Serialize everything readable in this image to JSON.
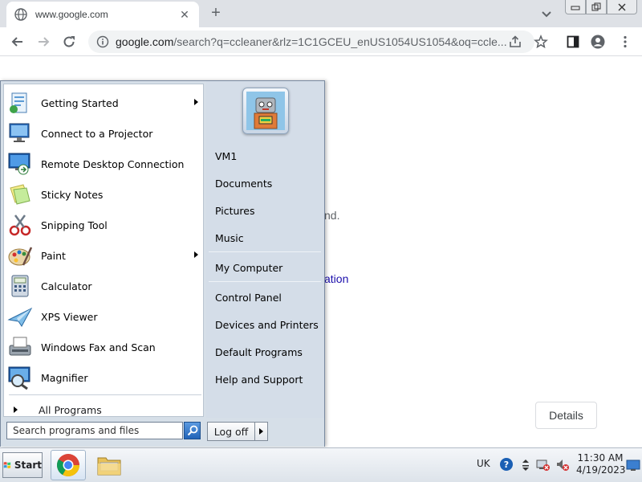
{
  "browser": {
    "tab_title": "www.google.com",
    "url_host": "google.com",
    "url_rest": "/search?q=ccleaner&rlz=1C1GCEU_enUS1054US1054&oq=ccle..."
  },
  "page": {
    "fragment_1": "nd.",
    "fragment_2": "ation",
    "details_label": "Details"
  },
  "start_menu": {
    "programs": [
      {
        "label": "Getting Started",
        "icon": "getting-started-icon",
        "submenu": true
      },
      {
        "label": "Connect to a Projector",
        "icon": "projector-icon",
        "submenu": false
      },
      {
        "label": "Remote Desktop Connection",
        "icon": "remote-desktop-icon",
        "submenu": false
      },
      {
        "label": "Sticky Notes",
        "icon": "sticky-notes-icon",
        "submenu": false
      },
      {
        "label": "Snipping Tool",
        "icon": "snipping-tool-icon",
        "submenu": false
      },
      {
        "label": "Paint",
        "icon": "paint-icon",
        "submenu": true
      },
      {
        "label": "Calculator",
        "icon": "calculator-icon",
        "submenu": false
      },
      {
        "label": "XPS Viewer",
        "icon": "xps-viewer-icon",
        "submenu": false
      },
      {
        "label": "Windows Fax and Scan",
        "icon": "fax-scan-icon",
        "submenu": false
      },
      {
        "label": "Magnifier",
        "icon": "magnifier-icon",
        "submenu": false
      }
    ],
    "all_programs": "All Programs",
    "right_items": [
      {
        "label": "VM1"
      },
      {
        "label": "Documents"
      },
      {
        "label": "Pictures"
      },
      {
        "label": "Music"
      },
      {
        "label": "My Computer"
      },
      {
        "label": "Control Panel"
      },
      {
        "label": "Devices and Printers"
      },
      {
        "label": "Default Programs"
      },
      {
        "label": "Help and Support"
      }
    ],
    "search_placeholder": "Search programs and files",
    "logoff_label": "Log off"
  },
  "taskbar": {
    "start_label": "Start",
    "language": "UK",
    "time": "11:30 AM",
    "date": "4/19/2023"
  }
}
